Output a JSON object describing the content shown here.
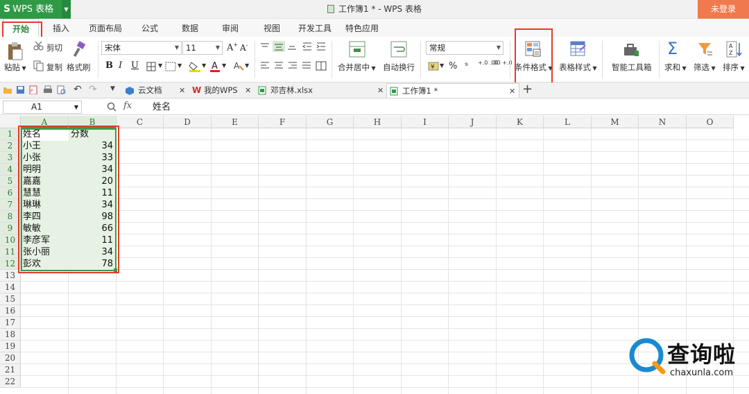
{
  "app": {
    "logo": "S",
    "name": "WPS 表格"
  },
  "window_title": "工作簿1 * - WPS 表格",
  "login_button": "未登录",
  "ribbon_tabs": [
    "开始",
    "插入",
    "页面布局",
    "公式",
    "数据",
    "审阅",
    "视图",
    "开发工具",
    "特色应用"
  ],
  "ribbon": {
    "cut": "剪切",
    "paste": "粘贴",
    "copy": "复制",
    "format_painter": "格式刷",
    "font_name": "宋体",
    "font_size": "11",
    "merge_center": "合并居中",
    "wrap_text": "自动换行",
    "number_format": "常规",
    "conditional_format": "条件格式",
    "table_style": "表格样式",
    "smart_toolbox": "智能工具箱",
    "sum": "求和",
    "filter": "筛选",
    "sort": "排序",
    "bold": "B",
    "italic": "I",
    "underline": "U",
    "percent": "%",
    "comma": "⁹",
    "inc_decimal": "+.0 .00",
    "dec_decimal": ".00 +.0"
  },
  "doc_tabs": [
    {
      "label": "云文档"
    },
    {
      "label": "我的WPS"
    },
    {
      "label": "邓吉林.xlsx"
    },
    {
      "label": "工作簿1 *"
    }
  ],
  "new_tab": "+",
  "formula_bar": {
    "cell_ref": "A1",
    "fx": "fx",
    "content": "姓名"
  },
  "columns": [
    "A",
    "B",
    "C",
    "D",
    "E",
    "F",
    "G",
    "H",
    "I",
    "J",
    "K",
    "L",
    "M",
    "N",
    "O"
  ],
  "rows": [
    "1",
    "2",
    "3",
    "4",
    "5",
    "6",
    "7",
    "8",
    "9",
    "10",
    "11",
    "12",
    "13",
    "14",
    "15",
    "16",
    "17",
    "18",
    "19",
    "20",
    "21",
    "22"
  ],
  "table": [
    [
      "姓名",
      "分数"
    ],
    [
      "小王",
      "34"
    ],
    [
      "小张",
      "33"
    ],
    [
      "明明",
      "34"
    ],
    [
      "嘉嘉",
      "20"
    ],
    [
      "慧慧",
      "11"
    ],
    [
      "琳琳",
      "34"
    ],
    [
      "李四",
      "98"
    ],
    [
      "敏敏",
      "66"
    ],
    [
      "李彦军",
      "11"
    ],
    [
      "张小丽",
      "34"
    ],
    [
      "彭欢",
      "78"
    ]
  ],
  "watermark": {
    "brand": "查询啦",
    "url": "chaxunla.com"
  },
  "colors": {
    "accent_green": "#2e9a46",
    "highlight_red": "#e43a2a",
    "login_orange": "#f07a4e",
    "selection_green": "#e6f2e3"
  }
}
